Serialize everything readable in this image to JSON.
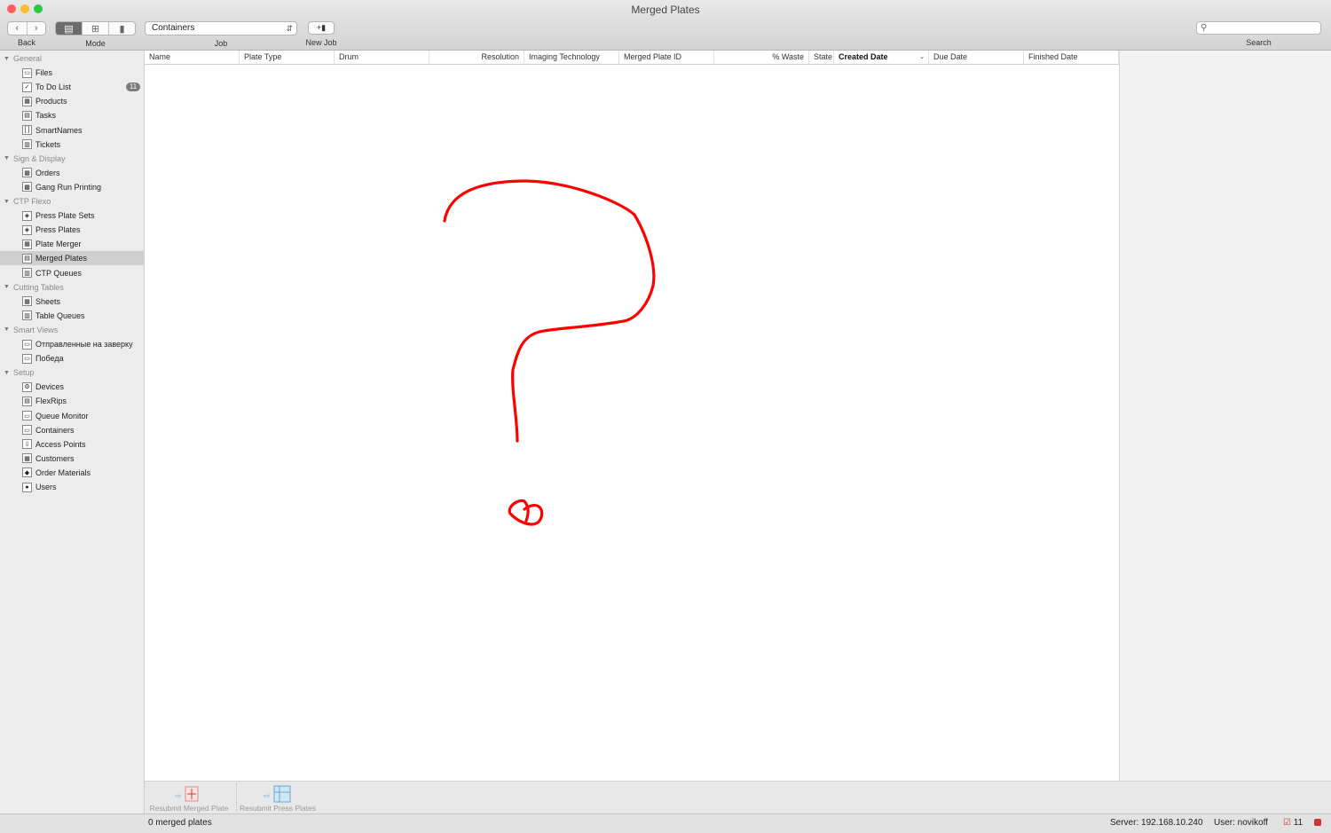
{
  "window": {
    "title": "Merged Plates"
  },
  "toolbar": {
    "back_label": "Back",
    "mode_label": "Mode",
    "job_label": "Job",
    "job_value": "Containers",
    "new_job_label": "New Job",
    "search_label": "Search",
    "search_value": ""
  },
  "sidebar": {
    "groups": [
      {
        "label": "General",
        "items": [
          {
            "label": "Files",
            "icon": "file-icon"
          },
          {
            "label": "To Do List",
            "icon": "todo-icon",
            "badge": "11"
          },
          {
            "label": "Products",
            "icon": "products-icon"
          },
          {
            "label": "Tasks",
            "icon": "tasks-icon"
          },
          {
            "label": "SmartNames",
            "icon": "smartnames-icon"
          },
          {
            "label": "Tickets",
            "icon": "tickets-icon"
          }
        ]
      },
      {
        "label": "Sign & Display",
        "items": [
          {
            "label": "Orders",
            "icon": "orders-icon"
          },
          {
            "label": "Gang Run Printing",
            "icon": "gang-run-icon"
          }
        ]
      },
      {
        "label": "CTP Flexo",
        "items": [
          {
            "label": "Press Plate Sets",
            "icon": "press-plate-sets-icon"
          },
          {
            "label": "Press Plates",
            "icon": "press-plates-icon"
          },
          {
            "label": "Plate Merger",
            "icon": "plate-merger-icon"
          },
          {
            "label": "Merged Plates",
            "icon": "merged-plates-icon",
            "selected": true
          },
          {
            "label": "CTP Queues",
            "icon": "ctp-queues-icon"
          }
        ]
      },
      {
        "label": "Cutting Tables",
        "items": [
          {
            "label": "Sheets",
            "icon": "sheets-icon"
          },
          {
            "label": "Table Queues",
            "icon": "table-queues-icon"
          }
        ]
      },
      {
        "label": "Smart Views",
        "items": [
          {
            "label": "Отправленные на заверку",
            "icon": "smart-view-icon"
          },
          {
            "label": "Победа",
            "icon": "smart-view-icon"
          }
        ]
      },
      {
        "label": "Setup",
        "items": [
          {
            "label": "Devices",
            "icon": "devices-icon"
          },
          {
            "label": "FlexRips",
            "icon": "flexrips-icon"
          },
          {
            "label": "Queue Monitor",
            "icon": "queue-monitor-icon"
          },
          {
            "label": "Containers",
            "icon": "containers-icon"
          },
          {
            "label": "Access Points",
            "icon": "access-points-icon"
          },
          {
            "label": "Customers",
            "icon": "customers-icon"
          },
          {
            "label": "Order Materials",
            "icon": "order-materials-icon"
          },
          {
            "label": "Users",
            "icon": "users-icon"
          }
        ]
      }
    ]
  },
  "table": {
    "columns": [
      "Name",
      "Plate Type",
      "Drum",
      "Resolution",
      "Imaging Technology",
      "Merged Plate ID",
      "% Waste",
      "State",
      "Created Date",
      "Due Date",
      "Finished Date"
    ],
    "sorted_column": "Created Date",
    "rows": []
  },
  "annotation": {
    "color": "#ff0000",
    "shape": "question-mark"
  },
  "actions": [
    {
      "label": "Resubmit Merged Plate",
      "enabled": false
    },
    {
      "label": "Resubmit Press Plates",
      "enabled": false
    }
  ],
  "status": {
    "count_text": "0 merged plates",
    "server_text": "Server: 192.168.10.240",
    "user_text": "User: novikoff",
    "todo_count": "11"
  }
}
